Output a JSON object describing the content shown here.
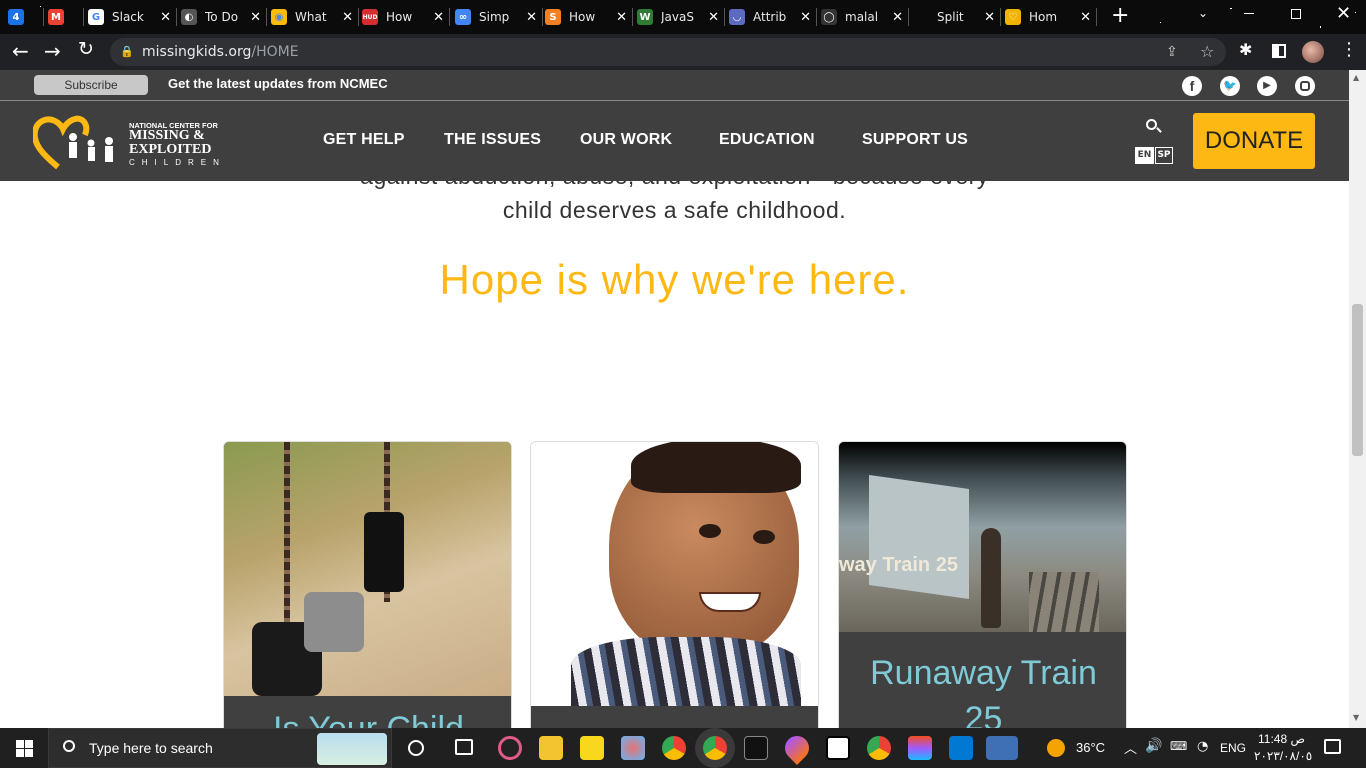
{
  "tabs": [
    {
      "title": "",
      "fav": "4",
      "color": "#1a73e8"
    },
    {
      "title": "",
      "fav": "M",
      "color": "#ea4335"
    },
    {
      "title": "Slack",
      "fav": "G",
      "color": "#ffffff"
    },
    {
      "title": "To Do",
      "fav": "◐",
      "color": "#555555"
    },
    {
      "title": "What",
      "fav": "◉",
      "color": "#fbbc04"
    },
    {
      "title": "How",
      "fav": "HUD",
      "color": "#d32f2f"
    },
    {
      "title": "Simp",
      "fav": "∞",
      "color": "#4285f4"
    },
    {
      "title": "How",
      "fav": "S",
      "color": "#f48024"
    },
    {
      "title": "JavaS",
      "fav": "W",
      "color": "#2e7d32"
    },
    {
      "title": "Attrib",
      "fav": "◡",
      "color": "#5c6bc0"
    },
    {
      "title": "malal",
      "fav": "◯",
      "color": "#333333"
    },
    {
      "title": "Split",
      "fav": "",
      "color": "#0b0b0b"
    },
    {
      "title": "Hom",
      "fav": "♡",
      "color": "#f0b400"
    }
  ],
  "browser": {
    "url_domain": "missingkids.org",
    "url_path": "/HOME"
  },
  "site": {
    "subscribe_label": "Subscribe",
    "updates_text": "Get the latest updates from NCMEC",
    "logo": {
      "line1": "NATIONAL CENTER FOR",
      "line2": "MISSING &",
      "line3": "EXPLOITED",
      "line4": "CHILDREN"
    },
    "nav": [
      "GET HELP",
      "THE ISSUES",
      "OUR WORK",
      "EDUCATION",
      "SUPPORT US"
    ],
    "lang_en": "EN",
    "lang_sp": "SP",
    "donate_label": "DONATE",
    "intro_line1": "against abduction, abuse, and exploitation - because every",
    "intro_line2": "child deserves a safe childhood.",
    "hope_heading": "Hope is why we're here.",
    "cards": [
      {
        "title": "Is Your Child"
      },
      {
        "title": ""
      },
      {
        "title": "Runaway Train 25",
        "video_caption": "way Train 25"
      }
    ]
  },
  "taskbar": {
    "search_placeholder": "Type here to search",
    "weather": "36°C",
    "lang": "ENG",
    "time": "11:48 ص",
    "date": "٢٠٢٣/٠٨/٠٥"
  },
  "colors": {
    "brand_yellow": "#fdb813",
    "nav_bg": "#3f3f3f",
    "accent_blue": "#7ecbd7"
  }
}
